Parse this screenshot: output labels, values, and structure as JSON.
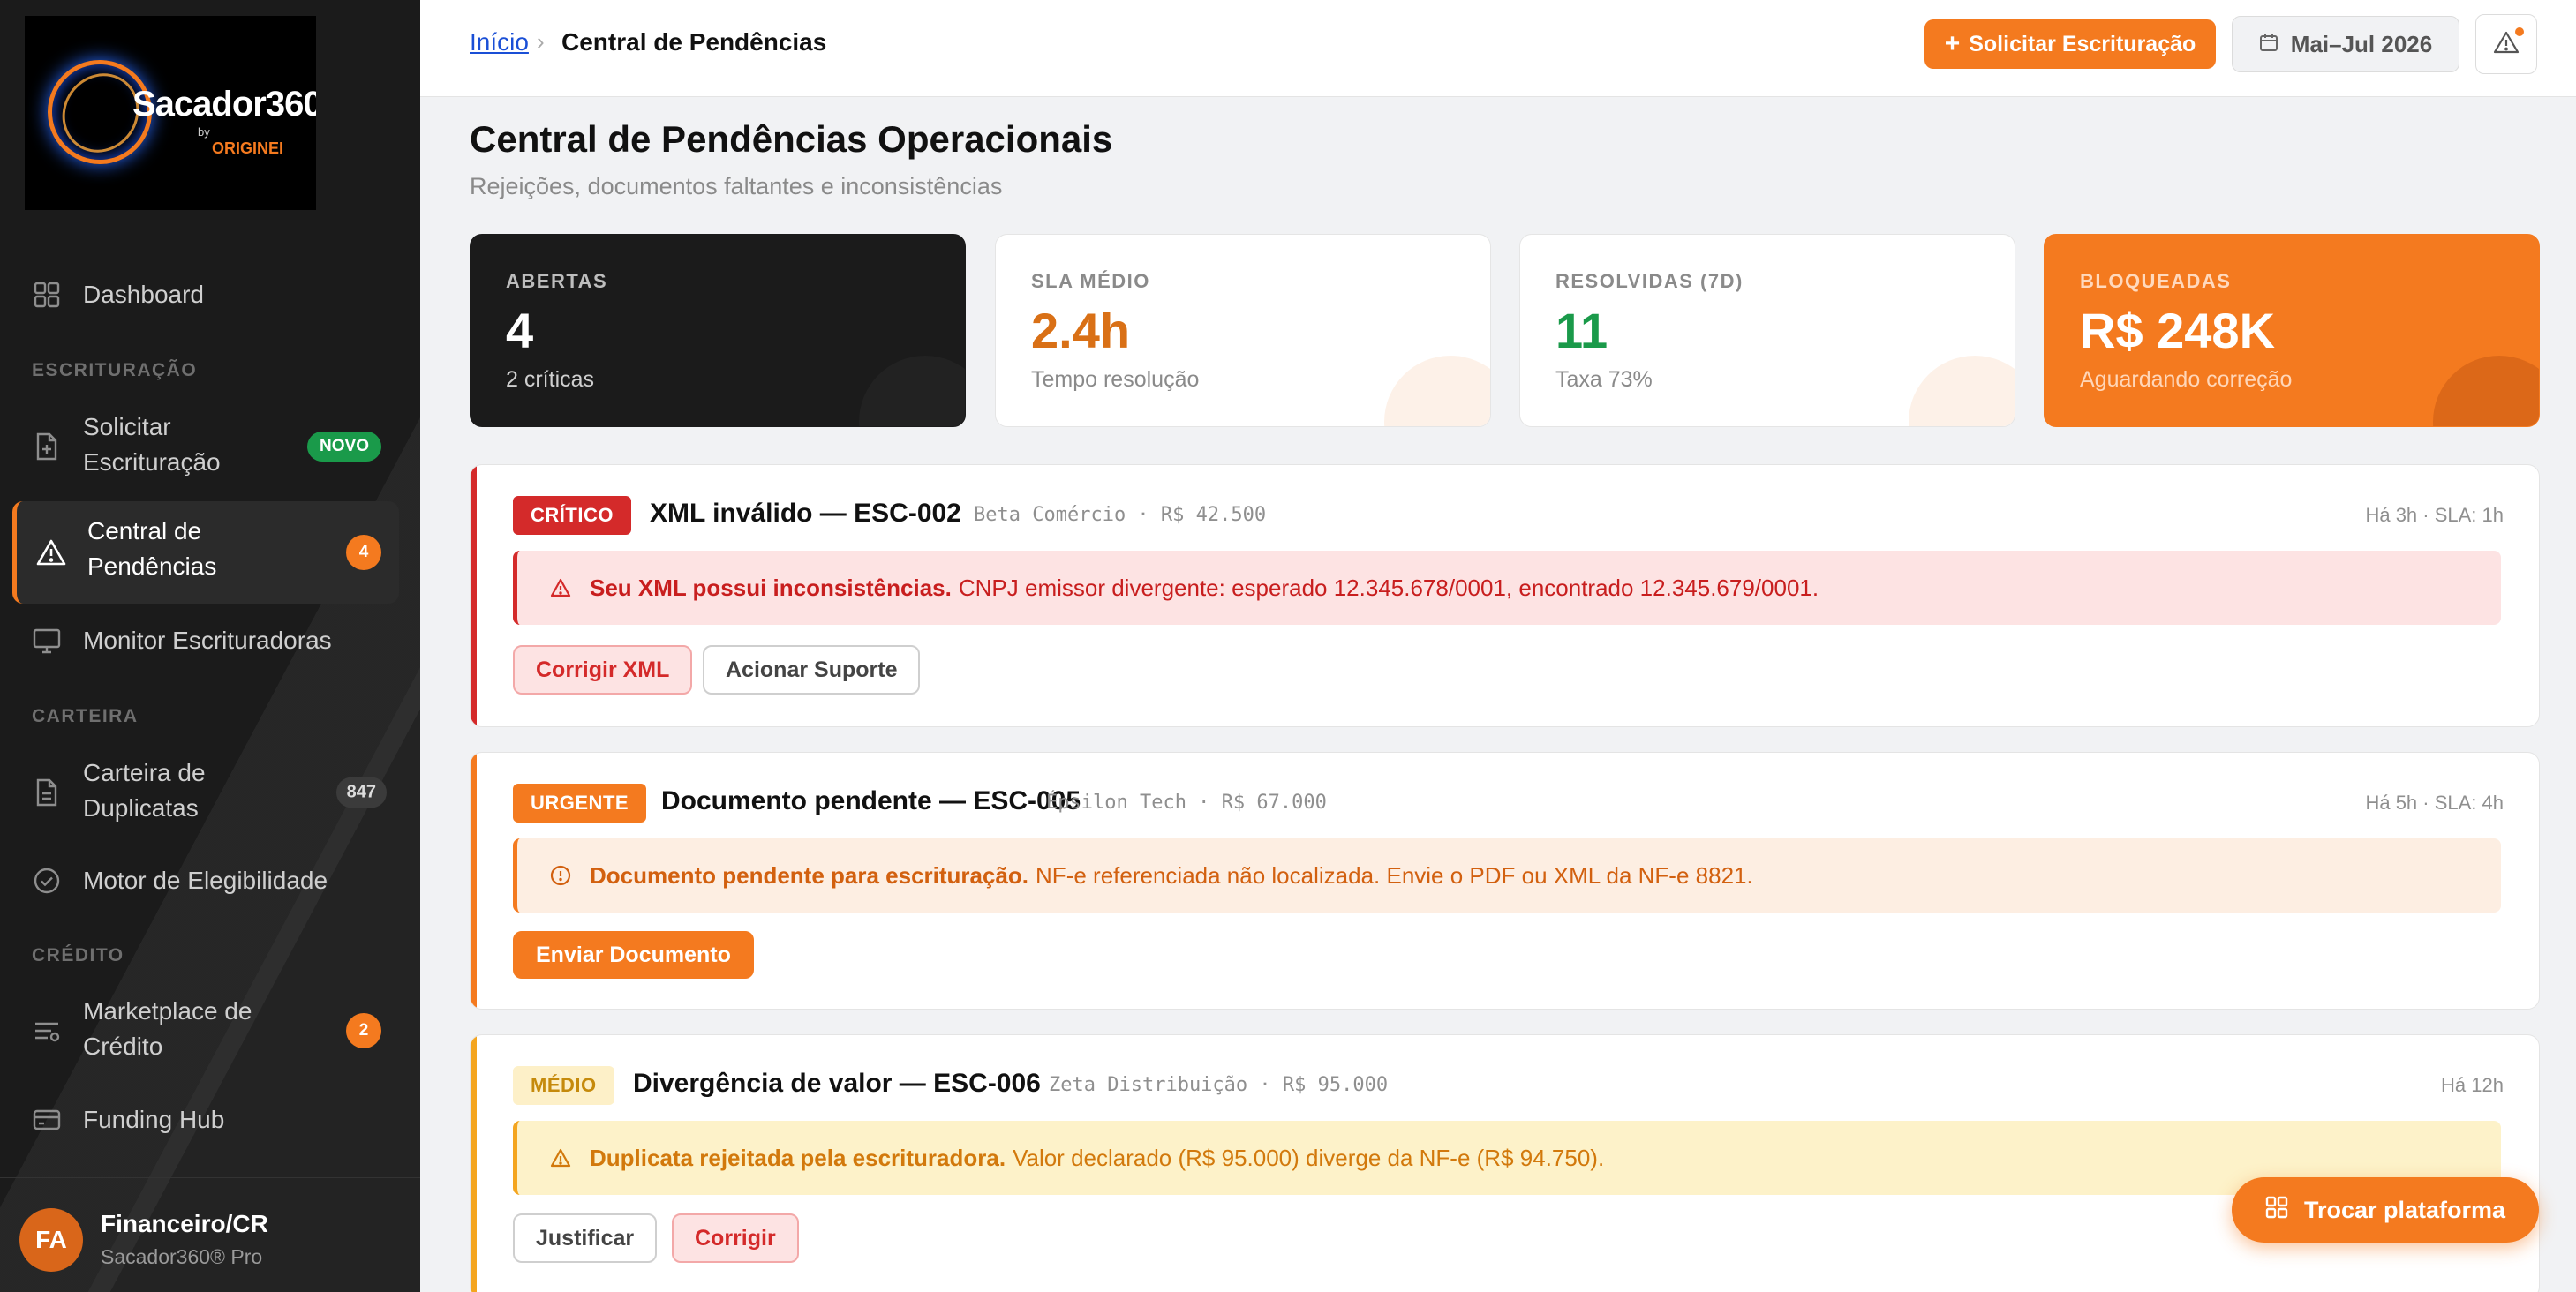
{
  "brand": {
    "logo_text": "Sacador360",
    "logo_by": "by",
    "logo_origin": "ORIGINEI"
  },
  "sidebar": {
    "items": [
      {
        "label": "Dashboard",
        "icon": "grid-icon"
      },
      {
        "section": "ESCRITURAÇÃO"
      },
      {
        "label": "Solicitar Escrituração",
        "icon": "document-icon",
        "badge": "NOVO"
      },
      {
        "label": "Central de Pendências",
        "icon": "warning-icon",
        "badge": "4",
        "active": true
      },
      {
        "label": "Monitor Escrituradoras",
        "icon": "monitor-icon"
      },
      {
        "section": "CARTEIRA"
      },
      {
        "label": "Carteira de Duplicatas",
        "icon": "file-icon",
        "badge": "847"
      },
      {
        "label": "Motor de Elegibilidade",
        "icon": "check-circle-icon"
      },
      {
        "section": "CRÉDITO"
      },
      {
        "label": "Marketplace de Crédito",
        "icon": "list-filter-icon",
        "badge": "2"
      },
      {
        "label": "Funding Hub",
        "icon": "card-icon"
      }
    ],
    "labels": {
      "dashboard": "Dashboard",
      "section_escrituracao": "ESCRITURAÇÃO",
      "solicitar_l1": "Solicitar",
      "solicitar_l2": "Escrituração",
      "solicitar_badge": "NOVO",
      "central_l1": "Central de",
      "central_l2": "Pendências",
      "central_badge": "4",
      "monitor": "Monitor Escrituradoras",
      "section_carteira": "CARTEIRA",
      "carteira_l1": "Carteira de",
      "carteira_l2": "Duplicatas",
      "carteira_badge": "847",
      "motor": "Motor de Elegibilidade",
      "section_credito": "CRÉDITO",
      "marketplace_l1": "Marketplace de",
      "marketplace_l2": "Crédito",
      "marketplace_badge": "2",
      "funding": "Funding Hub"
    },
    "user": {
      "initials": "FA",
      "name": "Financeiro/CR",
      "plan": "Sacador360® Pro"
    }
  },
  "topbar": {
    "breadcrumb_home": "Início",
    "breadcrumb_sep": "›",
    "breadcrumb_current": "Central de Pendências",
    "request_button": "Solicitar Escrituração",
    "date_range": "Mai–Jul 2026"
  },
  "page": {
    "title": "Central de Pendências Operacionais",
    "subtitle": "Rejeições, documentos faltantes e inconsistências"
  },
  "kpis": [
    {
      "label": "ABERTAS",
      "value": "4",
      "sub": "2 críticas"
    },
    {
      "label": "SLA MÉDIO",
      "value": "2.4h",
      "sub": "Tempo resolução",
      "color": "#d97016"
    },
    {
      "label": "RESOLVIDAS (7D)",
      "value": "11",
      "sub": "Taxa 73%",
      "color": "#1a9a4a"
    },
    {
      "label": "BLOQUEADAS",
      "value": "R$ 248K",
      "sub": "Aguardando correção"
    }
  ],
  "pendencias": [
    {
      "tag": "CRÍTICO",
      "title": "XML inválido — ESC-002",
      "meta": "Beta Comércio · R$ 42.500",
      "time": "Há 3h · SLA: 1h",
      "alert_strong": "Seu XML possui inconsistências.",
      "alert_text": "CNPJ emissor divergente: esperado 12.345.678/0001, encontrado 12.345.679/0001.",
      "actions": [
        "Corrigir XML",
        "Acionar Suporte"
      ],
      "color": "#d42a2a"
    },
    {
      "tag": "URGENTE",
      "title": "Documento pendente — ESC-005",
      "meta": "Épsilon Tech · R$ 67.000",
      "time": "Há 5h · SLA: 4h",
      "alert_strong": "Documento pendente para escrituração.",
      "alert_text": "NF-e referenciada não localizada. Envie o PDF ou XML da NF-e 8821.",
      "actions": [
        "Enviar Documento"
      ],
      "color": "#f47a1f"
    },
    {
      "tag": "MÉDIO",
      "title": "Divergência de valor — ESC-006",
      "meta": "Zeta Distribuição · R$ 95.000",
      "time": "Há 12h",
      "alert_strong": "Duplicata rejeitada pela escrituradora.",
      "alert_text": "Valor declarado (R$ 95.000) diverge da NF-e (R$ 94.750).",
      "actions": [
        "Justificar",
        "Corrigir"
      ],
      "color": "#f4a51f"
    }
  ],
  "float_button": "Trocar plataforma"
}
